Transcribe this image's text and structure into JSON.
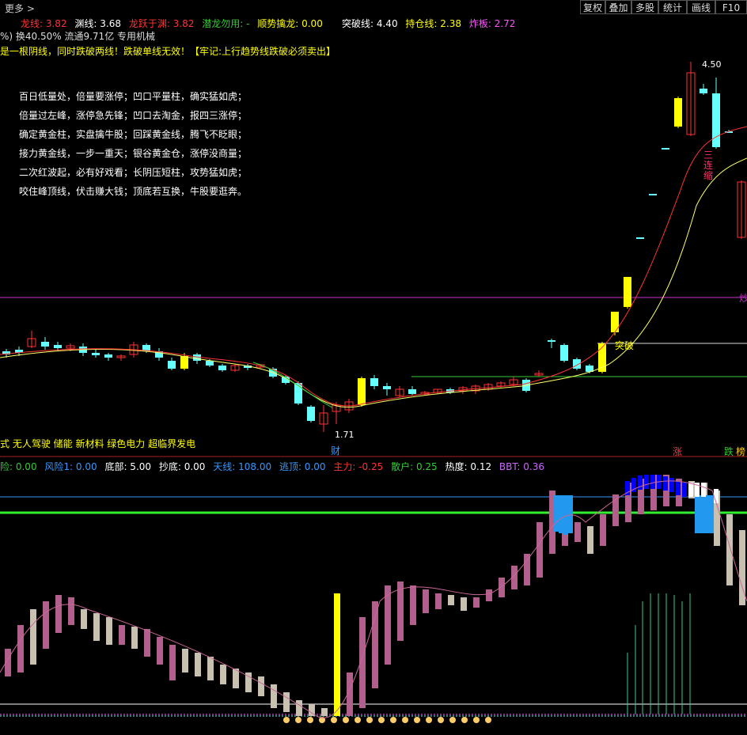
{
  "toolbar": {
    "more_label": "更多 >",
    "buttons": [
      "复权",
      "叠加",
      "多股",
      "统计",
      "画线",
      "F10"
    ]
  },
  "indicator_row1": [
    {
      "text": "龙线: 3.82",
      "color": "#ff3333"
    },
    {
      "text": "渊线: 3.68",
      "color": "#ffffff"
    },
    {
      "text": "龙跃于渊: 3.82",
      "color": "#ff3333"
    },
    {
      "text": "潜龙勿用: -",
      "color": "#33cc33"
    },
    {
      "text": "顺势擒龙: 0.00",
      "color": "#ffff00"
    },
    {
      "text": "突破线: 4.40",
      "color": "#ffffff"
    },
    {
      "text": "持仓线: 2.38",
      "color": "#ffff00"
    },
    {
      "text": "炸板: 2.72",
      "color": "#ff55ff"
    }
  ],
  "info_row": "%) 换40.50% 流通9.71亿 专用机械",
  "warning_text": "是一根阴线，同时跌破两线！跌破单线无效！【牢记:上行趋势线跌破必须卖出】",
  "verses": [
    "百日低量处，倍量要涨停；凹口平量柱，确实猛如虎；",
    "倍量过左峰，涨停急先锋；凹口去淘金，报四三涨停；",
    "确定黄金柱，实盘擒牛股；回踩黄金线，腾飞不眨眼；",
    "接力黄金线，一步一重天；银谷黄金仓，涨停没商量；",
    "二次红波起，必有好戏看；长阴压短柱，攻势猛如虎；",
    "咬住峰顶线，伏击赚大钱；顶底若互换，牛股要逛奔。"
  ],
  "concepts": "式 无人驾驶 储能 新材料 绿色电力 超临界发电",
  "labels": {
    "high_price": "4.50",
    "low_price": "1.71",
    "breakout": "突破",
    "three_limit": [
      "三",
      "连",
      "缩"
    ],
    "cai": "财",
    "zhang": "涨",
    "die": "跌",
    "bang": "榜",
    "right_edge": "炒"
  },
  "indicator_row2": [
    {
      "text": "险: 0.00",
      "color": "#33cc33"
    },
    {
      "text": "风险1: 0.00",
      "color": "#3399ff"
    },
    {
      "text": "底部: 5.00",
      "color": "#ffffff"
    },
    {
      "text": "抄底: 0.00",
      "color": "#ffffff"
    },
    {
      "text": "天线: 108.00",
      "color": "#3399ff"
    },
    {
      "text": "逃顶: 0.00",
      "color": "#3399ff"
    },
    {
      "text": "主力: -0.25",
      "color": "#ff3333"
    },
    {
      "text": "散户: 0.25",
      "color": "#33cc33"
    },
    {
      "text": "热度: 0.12",
      "color": "#ffffff"
    },
    {
      "text": "BBT: 0.36",
      "color": "#cc66ff"
    }
  ],
  "colors": {
    "up": "#ff3333",
    "down": "#66ffff",
    "limit": "#ffff00",
    "magenta_line": "#cc33cc",
    "green_line": "#33cc33"
  }
}
